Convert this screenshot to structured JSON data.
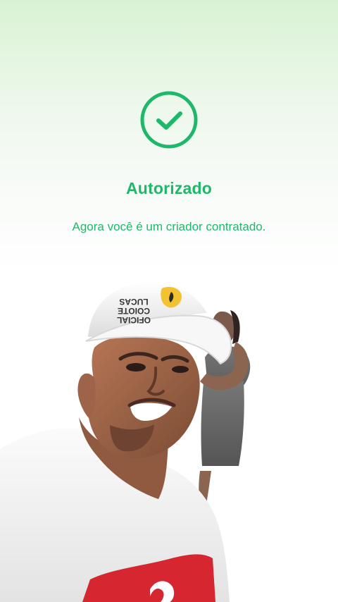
{
  "auth": {
    "title": "Autorizado",
    "message": "Agora você é um criador contratado.",
    "icon": "check-circle-icon",
    "accent_color": "#1fb86a"
  },
  "photo": {
    "cap_text": [
      "LUCAS",
      "COIOTE",
      "OFICIAL"
    ]
  }
}
